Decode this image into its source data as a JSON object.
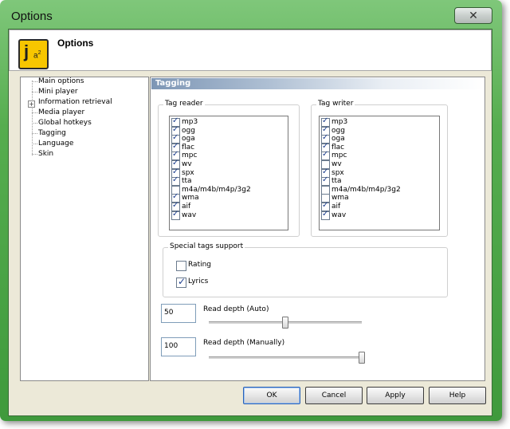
{
  "window": {
    "title": "Options",
    "close_glyph": "✕"
  },
  "header": {
    "title": "Options",
    "logo_j": "j",
    "logo_a": "a",
    "logo_sup": "2"
  },
  "nav": {
    "items": [
      {
        "label": "Main options"
      },
      {
        "label": "Mini player"
      },
      {
        "label": "Information retrieval",
        "expandable": true
      },
      {
        "label": "Media player"
      },
      {
        "label": "Global hotkeys"
      },
      {
        "label": "Tagging",
        "selected": true
      },
      {
        "label": "Language"
      },
      {
        "label": "Skin"
      }
    ]
  },
  "section": {
    "title": "Tagging"
  },
  "tag_reader": {
    "label": "Tag reader",
    "items": [
      {
        "label": "mp3",
        "checked": true
      },
      {
        "label": "ogg",
        "checked": true
      },
      {
        "label": "oga",
        "checked": true
      },
      {
        "label": "flac",
        "checked": true
      },
      {
        "label": "mpc",
        "checked": true
      },
      {
        "label": "wv",
        "checked": true
      },
      {
        "label": "spx",
        "checked": true
      },
      {
        "label": "tta",
        "checked": true
      },
      {
        "label": "m4a/m4b/m4p/3g2",
        "checked": false
      },
      {
        "label": "wma",
        "checked": true
      },
      {
        "label": "aif",
        "checked": true
      },
      {
        "label": "wav",
        "checked": true
      }
    ]
  },
  "tag_writer": {
    "label": "Tag writer",
    "items": [
      {
        "label": "mp3",
        "checked": true
      },
      {
        "label": "ogg",
        "checked": true
      },
      {
        "label": "oga",
        "checked": true
      },
      {
        "label": "flac",
        "checked": true
      },
      {
        "label": "mpc",
        "checked": true
      },
      {
        "label": "wv",
        "checked": false
      },
      {
        "label": "spx",
        "checked": true
      },
      {
        "label": "tta",
        "checked": true
      },
      {
        "label": "m4a/m4b/m4p/3g2",
        "checked": false
      },
      {
        "label": "wma",
        "checked": false
      },
      {
        "label": "aif",
        "checked": true
      },
      {
        "label": "wav",
        "checked": true
      }
    ]
  },
  "special_tags": {
    "label": "Special tags support",
    "rating": {
      "label": "Rating",
      "checked": false
    },
    "lyrics": {
      "label": "Lyrics",
      "checked": true
    }
  },
  "read_depth_auto": {
    "value": "50",
    "label": "Read depth (Auto)",
    "slider_fraction": 0.5
  },
  "read_depth_manual": {
    "value": "100",
    "label": "Read depth (Manually)",
    "slider_fraction": 1.0
  },
  "buttons": {
    "ok": "OK",
    "cancel": "Cancel",
    "apply": "Apply",
    "help": "Help"
  }
}
